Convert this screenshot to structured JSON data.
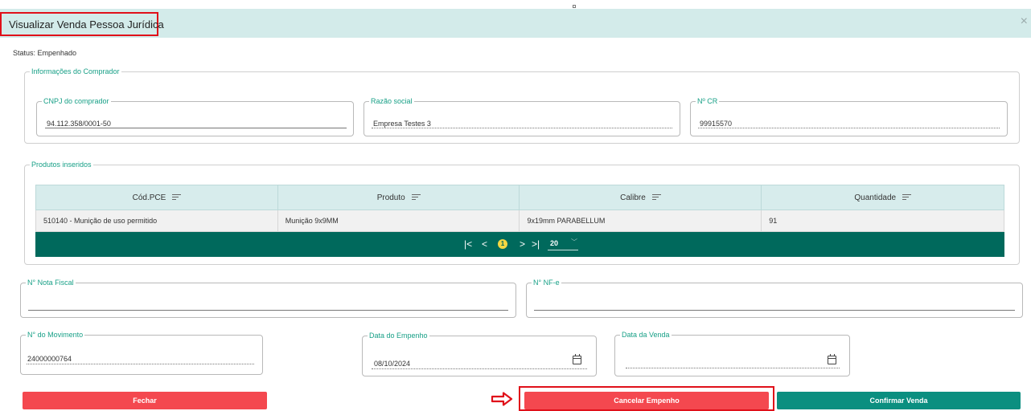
{
  "modal": {
    "title": "Visualizar Venda Pessoa Jurídica",
    "close_icon": "×"
  },
  "status_text": "Status: Empenhado",
  "buyer_section": {
    "legend": "Informações do Comprador",
    "cnpj": {
      "label": "CNPJ do comprador",
      "value": "94.112.358/0001-50"
    },
    "razao": {
      "label": "Razão social",
      "value": "Empresa Testes 3"
    },
    "cr": {
      "label": "Nº CR",
      "value": "99915570"
    }
  },
  "products_section": {
    "legend": "Produtos inseridos",
    "columns": [
      "Cód.PCE",
      "Produto",
      "Calibre",
      "Quantidade"
    ],
    "rows": [
      [
        "510140 - Munição de uso permitido",
        "Munição 9x9MM",
        "9x19mm PARABELLUM",
        "91"
      ]
    ],
    "pagination": {
      "first": "|<",
      "prev": "<",
      "current_page": "1",
      "next": ">",
      "last": ">|",
      "page_size": "20",
      "page_size_arrow": "﹀"
    }
  },
  "nota_fiscal": {
    "label": "N° Nota Fiscal",
    "value": ""
  },
  "nfe": {
    "label": "N° NF-e",
    "value": ""
  },
  "movimento": {
    "label": "N° do Movimento",
    "value": "24000000764"
  },
  "data_empenho": {
    "label": "Data do Empenho",
    "value": "08/10/2024"
  },
  "data_venda": {
    "label": "Data da Venda",
    "value": ""
  },
  "buttons": {
    "fechar": "Fechar",
    "cancelar_empenho": "Cancelar Empenho",
    "confirmar_venda": "Confirmar Venda"
  },
  "colors": {
    "header_bg": "#d3ebea",
    "accent_green": "#18a087",
    "pager_bg": "#00695c",
    "danger": "#f4484f",
    "teal_button": "#0b8f80",
    "annotation_red": "#e0101a"
  },
  "icons": {
    "close": "close-icon",
    "calendar": "calendar-icon",
    "sort": "sort-icon",
    "annotation_arrow": "arrow-right-icon"
  }
}
